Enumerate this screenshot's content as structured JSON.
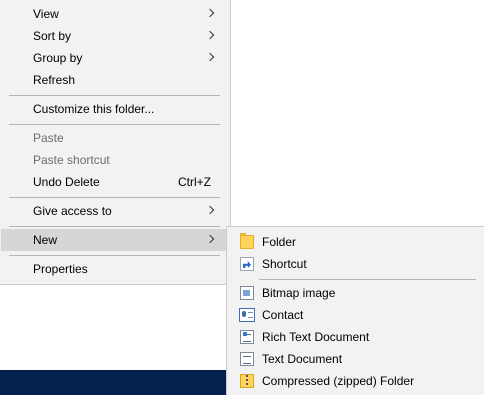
{
  "context_menu": {
    "view": "View",
    "sort_by": "Sort by",
    "group_by": "Group by",
    "refresh": "Refresh",
    "customize": "Customize this folder...",
    "paste": "Paste",
    "paste_shortcut": "Paste shortcut",
    "undo_delete": "Undo Delete",
    "undo_delete_shortcut": "Ctrl+Z",
    "give_access": "Give access to",
    "new": "New",
    "properties": "Properties"
  },
  "new_submenu": {
    "items": [
      {
        "label": "Folder",
        "icon": "folder-icon"
      },
      {
        "label": "Shortcut",
        "icon": "shortcut-icon"
      },
      {
        "label": "Bitmap image",
        "icon": "bitmap-icon"
      },
      {
        "label": "Contact",
        "icon": "contact-card-icon"
      },
      {
        "label": "Rich Text Document",
        "icon": "rich-text-document-icon"
      },
      {
        "label": "Text Document",
        "icon": "text-document-icon"
      },
      {
        "label": "Compressed (zipped) Folder",
        "icon": "zipped-folder-icon"
      }
    ]
  },
  "colors": {
    "menu_background": "#f2f2f2",
    "highlight": "#d6d6d6",
    "disabled_text": "#6d6d6d",
    "taskbar": "#032250"
  }
}
